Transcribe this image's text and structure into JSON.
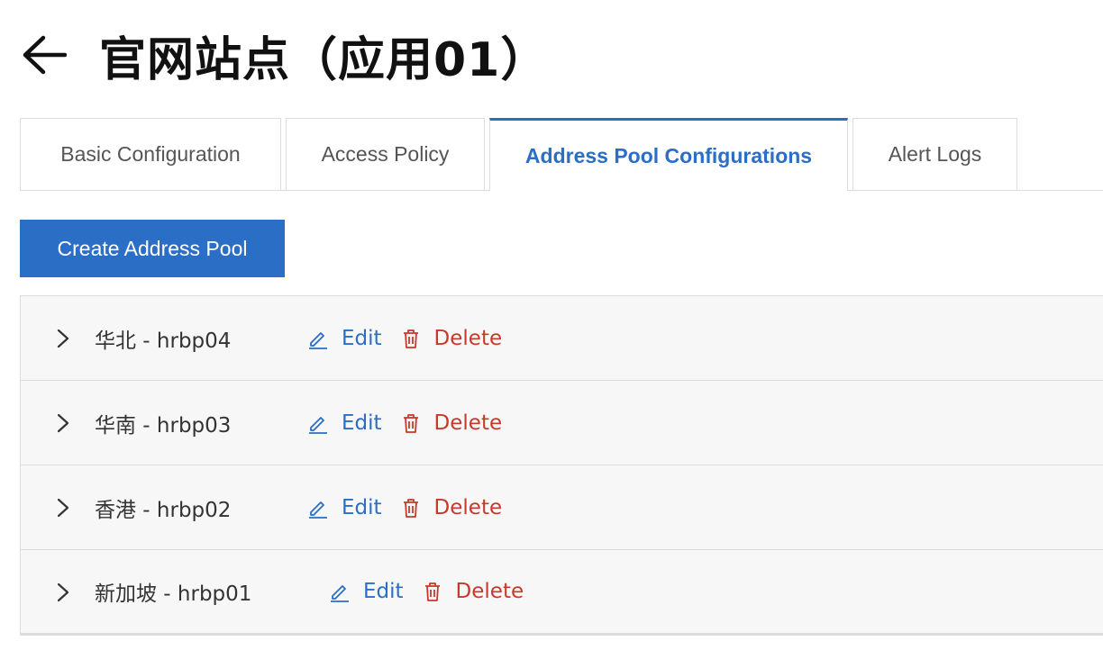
{
  "header": {
    "back_icon": "arrow-left-icon",
    "title": "官网站点（应用01）"
  },
  "tabs": [
    {
      "label": "Basic Configuration",
      "active": false
    },
    {
      "label": "Access Policy",
      "active": false
    },
    {
      "label": "Address Pool Configurations",
      "active": true
    },
    {
      "label": "Alert Logs",
      "active": false
    }
  ],
  "create_button": {
    "label": "Create Address Pool"
  },
  "pools": [
    {
      "name": "华北 - hrbp04",
      "edit_label": "Edit",
      "delete_label": "Delete"
    },
    {
      "name": "华南 - hrbp03",
      "edit_label": "Edit",
      "delete_label": "Delete"
    },
    {
      "name": "香港 - hrbp02",
      "edit_label": "Edit",
      "delete_label": "Delete"
    },
    {
      "name": "新加坡 - hrbp01",
      "edit_label": "Edit",
      "delete_label": "Delete"
    }
  ],
  "colors": {
    "accent": "#2a6ec6",
    "danger": "#c8392b",
    "row_bg": "#f7f7f7",
    "border": "#dcdcdc"
  },
  "icons": [
    "arrow-left-icon",
    "chevron-right-icon",
    "edit-icon",
    "trash-icon"
  ]
}
